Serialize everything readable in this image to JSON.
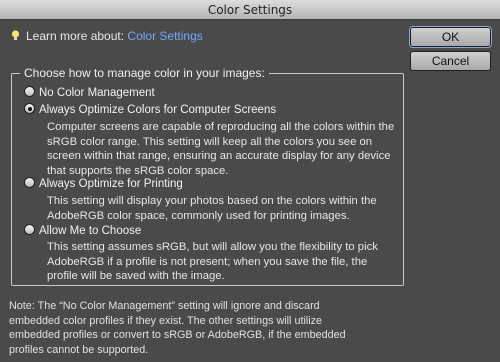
{
  "window": {
    "title": "Color Settings"
  },
  "learn_more": {
    "prefix": "Learn more about:",
    "link": "Color Settings"
  },
  "buttons": {
    "ok": "OK",
    "cancel": "Cancel"
  },
  "group": {
    "legend": "Choose how to manage color in your images:",
    "options": [
      {
        "label": "No Color Management",
        "selected": false,
        "description": ""
      },
      {
        "label": "Always Optimize Colors for Computer Screens",
        "selected": true,
        "description": "Computer screens are capable of reproducing all the colors within the sRGB color range. This setting will keep all the colors you see on screen within that range, ensuring an accurate display for any device that supports the sRGB color space."
      },
      {
        "label": "Always Optimize for Printing",
        "selected": false,
        "description": "This setting will display your photos based on the colors within the AdobeRGB color space, commonly used for printing images."
      },
      {
        "label": "Allow Me to Choose",
        "selected": false,
        "description": "This setting assumes sRGB, but will allow you the flexibility to pick AdobeRGB if a profile is not present; when you save the file, the profile will be saved with the image."
      }
    ]
  },
  "note": "Note: The “No Color Management” setting will ignore and discard embedded color profiles if they exist. The other settings will utilize embedded profiles or convert to sRGB or AdobeRGB, if the embedded profiles cannot be supported.",
  "icons": {
    "lightbulb": "lightbulb-icon",
    "radio_selected": "radio-selected",
    "radio_unselected": "radio-unselected"
  }
}
